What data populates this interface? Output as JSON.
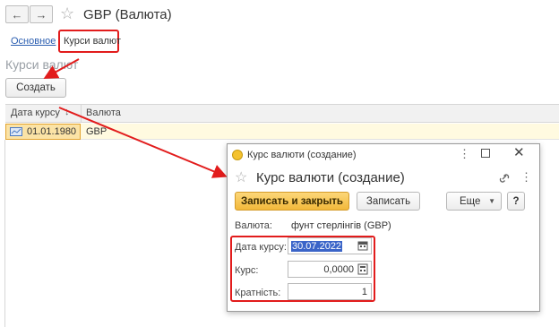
{
  "window": {
    "title": "GBP (Валюта)"
  },
  "nav": {
    "back": "←",
    "forward": "→",
    "star": "☆"
  },
  "tabs": {
    "main": "Основное",
    "rates": "Курси валют"
  },
  "section": {
    "title": "Курси валют",
    "create_label": "Создать"
  },
  "table": {
    "columns": [
      "Дата курсу",
      "Валюта"
    ],
    "sort_icon": "↓",
    "rows": [
      {
        "date": "01.01.1980",
        "currency": "GBP"
      }
    ]
  },
  "dialog": {
    "window_title": "Курс валюти (создание)",
    "heading": "Курс валюти (создание)",
    "save_close_label": "Записать и закрыть",
    "save_label": "Записать",
    "more_label": "Еще",
    "help_label": "?",
    "currency_label": "Валюта:",
    "currency_value": "фунт стерлінгів (GBP)",
    "date_label": "Дата курсу:",
    "date_value": "30.07.2022",
    "rate_label": "Курс:",
    "rate_value": "0,0000",
    "multiplicity_label": "Кратність:",
    "multiplicity_value": "1"
  },
  "colors": {
    "accent": "#f7c04a",
    "annotation": "#e21c1c",
    "link": "#2a5db0"
  }
}
